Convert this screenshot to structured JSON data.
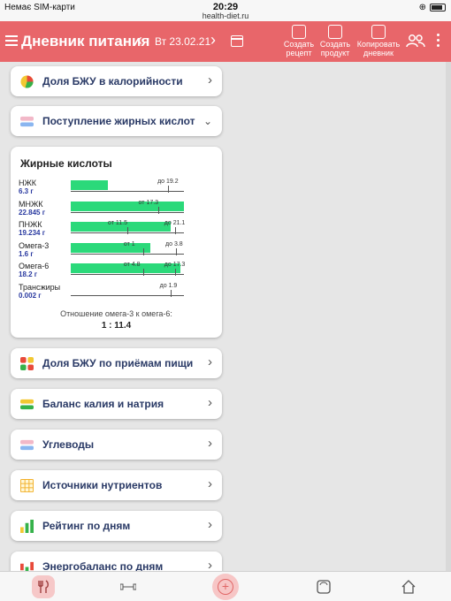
{
  "status_bar": {
    "carrier": "Немає SIM-карти",
    "time": "20:29",
    "url": "health-diet.ru"
  },
  "header": {
    "title": "Дневник питания",
    "date": "Вт 23.02.21",
    "create_recipe": [
      "Создать",
      "рецепт"
    ],
    "create_product": [
      "Создать",
      "продукт"
    ],
    "copy_diary": [
      "Копировать",
      "дневник"
    ]
  },
  "cards": {
    "bju_calories": "Доля БЖУ в калорийности",
    "fatty_acids_intake": "Поступление жирных кислот",
    "bju_meals": "Доля БЖУ по приёмам пищи",
    "potassium_sodium": "Баланс калия и натрия",
    "carbs": "Углеводы",
    "nutrient_sources": "Источники нутриентов",
    "daily_rating": "Рейтинг по дням",
    "energy_balance": "Энергобаланс по дням"
  },
  "fatty_acids": {
    "title": "Жирные кислоты",
    "rows": [
      {
        "name": "НЖК",
        "value": "6.3 г",
        "fill": 0.33,
        "from": null,
        "to": "19.2",
        "from_pos": null,
        "to_pos": 0.86
      },
      {
        "name": "МНЖК",
        "value": "22.845 г",
        "fill": 1.0,
        "from": "17.3",
        "to": null,
        "from_pos": 0.77,
        "to_pos": null
      },
      {
        "name": "ПНЖК",
        "value": "19.234 г",
        "fill": 0.88,
        "from": "11.5",
        "to": "21.1",
        "from_pos": 0.5,
        "to_pos": 0.92
      },
      {
        "name": "Омега-3",
        "value": "1.6 г",
        "fill": 0.7,
        "from": "1",
        "to": "3.8",
        "from_pos": 0.64,
        "to_pos": 0.93
      },
      {
        "name": "Омега-6",
        "value": "18.2 г",
        "fill": 0.97,
        "from": "4.8",
        "to": "17.3",
        "from_pos": 0.64,
        "to_pos": 0.92
      },
      {
        "name": "Трансжиры",
        "value": "0.002 г",
        "fill": 0.0,
        "from": null,
        "to": "1.9",
        "from_pos": null,
        "to_pos": 0.88
      }
    ],
    "ratio_label": "Отношение омега-3 к омега-6:",
    "ratio_value": "1 : 11.4"
  },
  "colors": {
    "header": "#e8666a",
    "bar": "#2bd97a",
    "label": "#2a3a66"
  }
}
